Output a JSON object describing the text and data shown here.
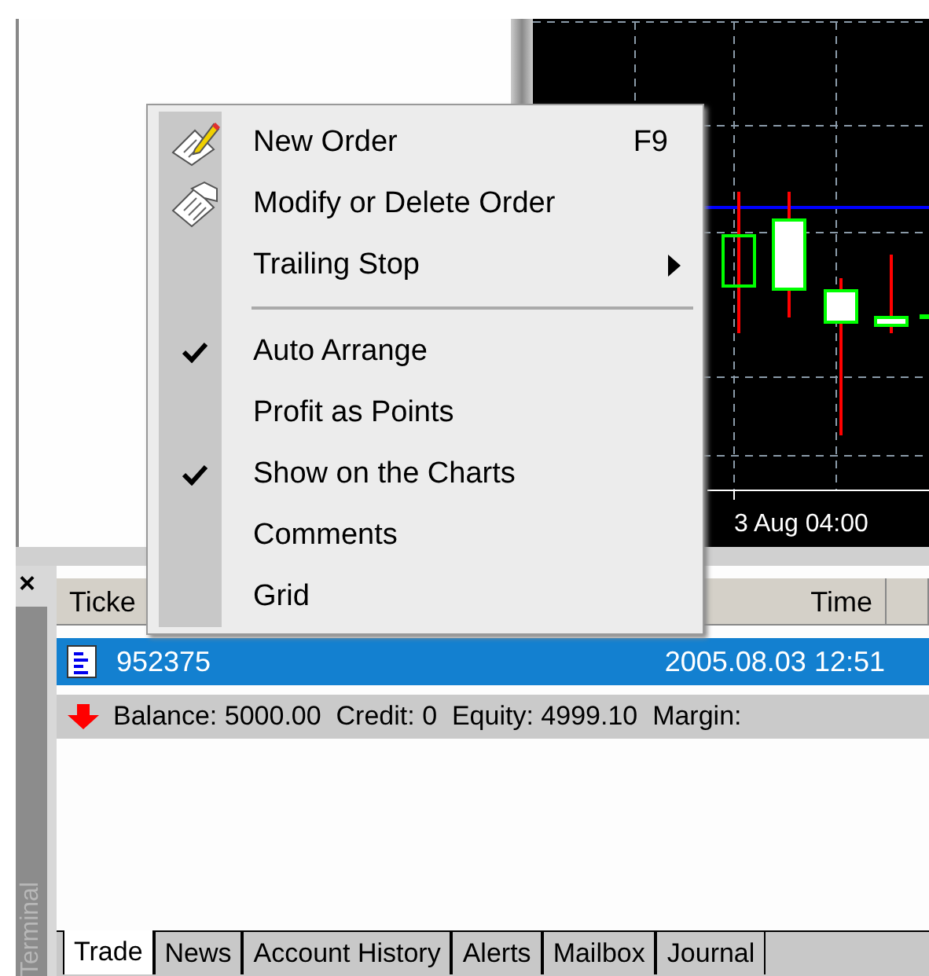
{
  "chart": {
    "time_label": "3 Aug 04:00"
  },
  "context_menu": {
    "items": [
      {
        "kind": "icon",
        "label": "New Order",
        "shortcut": "F9"
      },
      {
        "kind": "icon",
        "label": "Modify or Delete Order"
      },
      {
        "kind": "submenu",
        "label": "Trailing Stop"
      },
      {
        "kind": "separator"
      },
      {
        "kind": "check",
        "label": "Auto Arrange",
        "checked": true
      },
      {
        "kind": "check",
        "label": "Profit as Points",
        "checked": false
      },
      {
        "kind": "check",
        "label": "Show on the Charts",
        "checked": true
      },
      {
        "kind": "check",
        "label": "Comments",
        "checked": false
      },
      {
        "kind": "check",
        "label": "Grid",
        "checked": false
      }
    ]
  },
  "terminal": {
    "title": "Terminal",
    "close": "×",
    "table": {
      "columns": [
        {
          "label": "Ticke"
        },
        {
          "label": "Time"
        }
      ],
      "rows": [
        {
          "ticket": "952375",
          "time": "2005.08.03 12:51",
          "selected": true
        }
      ],
      "summary": "Balance: 5000.00  Credit: 0  Equity: 4999.10  Margin:"
    },
    "tabs": [
      {
        "label": "Trade",
        "selected": true
      },
      {
        "label": "News",
        "selected": false
      },
      {
        "label": "Account History",
        "selected": false
      },
      {
        "label": "Alerts",
        "selected": false
      },
      {
        "label": "Mailbox",
        "selected": false
      },
      {
        "label": "Journal",
        "selected": false
      }
    ]
  }
}
